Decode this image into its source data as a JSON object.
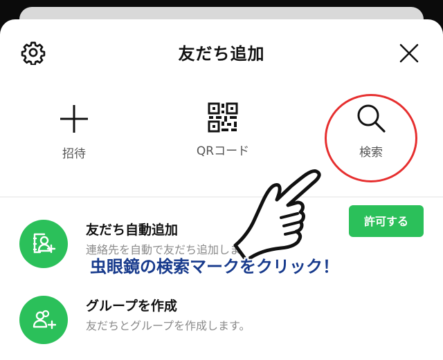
{
  "header": {
    "title": "友だち追加",
    "settings_icon": "gear-icon",
    "close_icon": "close-icon"
  },
  "actions": [
    {
      "label": "招待",
      "icon": "plus-icon"
    },
    {
      "label": "QRコード",
      "icon": "qr-code-icon"
    },
    {
      "label": "検索",
      "icon": "search-icon"
    }
  ],
  "rows": [
    {
      "title": "友だち自動追加",
      "subtitle": "連絡先を自動で友だち追加します。",
      "icon": "contacts-add-icon",
      "button_label": "許可する"
    },
    {
      "title": "グループを作成",
      "subtitle": "友だちとグループを作成します。",
      "icon": "group-add-icon"
    }
  ],
  "annotation": {
    "caption": "虫眼鏡の検索マークをクリック！",
    "pointer_icon": "pointing-hand-icon",
    "highlight_color": "#e62f2f",
    "caption_color": "#173a8c"
  },
  "colors": {
    "accent": "#2bc05a"
  }
}
